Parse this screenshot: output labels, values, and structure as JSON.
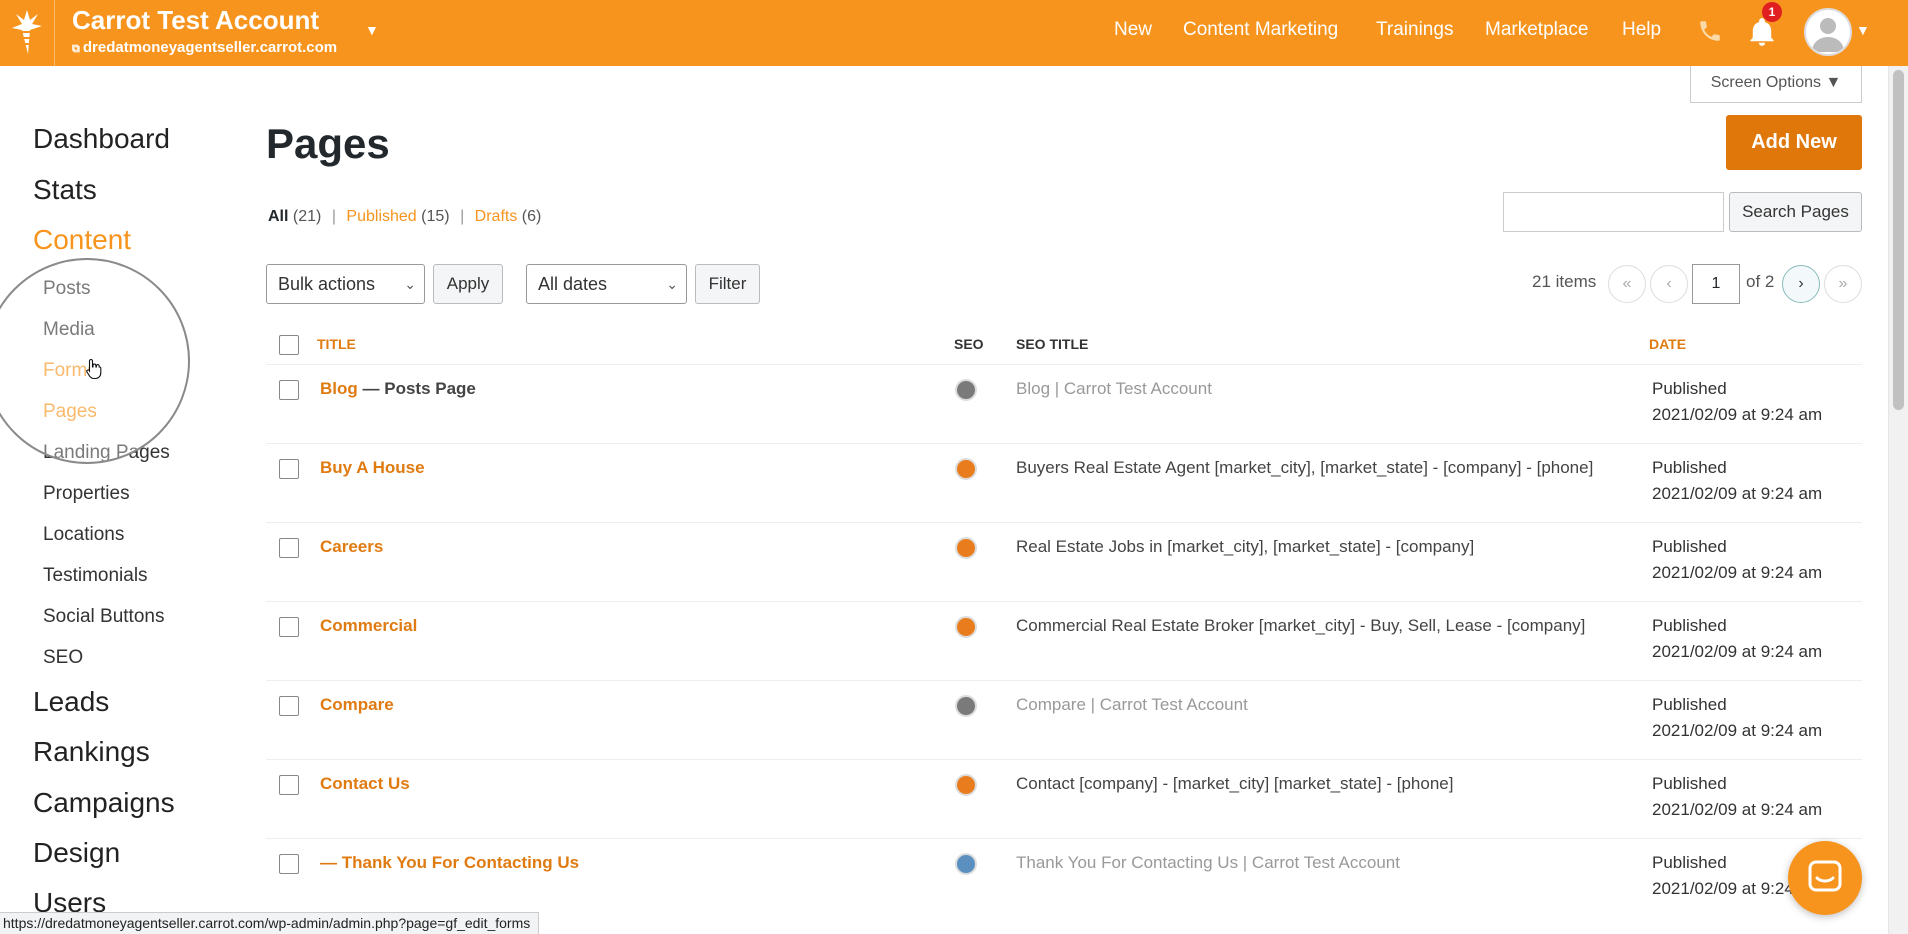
{
  "topbar": {
    "account_name": "Carrot Test Account",
    "account_url": "dredatmoneyagentseller.carrot.com",
    "nav": [
      "New",
      "Content Marketing",
      "Trainings",
      "Marketplace",
      "Help"
    ],
    "notification_count": "1",
    "accent_color": "#f7941d"
  },
  "sidebar": {
    "main_items": [
      "Dashboard",
      "Stats",
      "Content",
      "Leads",
      "Rankings",
      "Campaigns",
      "Design",
      "Users"
    ],
    "sub_items": [
      "Posts",
      "Media",
      "Forms",
      "Pages",
      "Landing Pages",
      "Properties",
      "Locations",
      "Testimonials",
      "Social Buttons",
      "SEO"
    ]
  },
  "screen_options": "Screen Options ▼",
  "page_title": "Pages",
  "add_new": "Add New",
  "filters": {
    "all_label": "All",
    "all_count": "(21)",
    "published_label": "Published",
    "published_count": "(15)",
    "drafts_label": "Drafts",
    "drafts_count": "(6)"
  },
  "search_button": "Search Pages",
  "bulk_actions": "Bulk actions",
  "apply": "Apply",
  "all_dates": "All dates",
  "filter": "Filter",
  "pagination": {
    "items": "21 items",
    "current_page": "1",
    "of_pages": "of 2",
    "first": "«",
    "prev": "‹",
    "next": "›",
    "last": "»"
  },
  "table": {
    "headers": {
      "title": "TITLE",
      "seo": "SEO",
      "seo_title": "SEO TITLE",
      "date": "DATE"
    },
    "rows": [
      {
        "title": "Blog",
        "suffix": " — Posts Page",
        "seo_color": "#7a7a7a",
        "seo_title": "Blog | Carrot Test Account",
        "muted": true,
        "status": "Published",
        "date": "2021/02/09 at 9:24 am"
      },
      {
        "title": "Buy A House",
        "suffix": "",
        "seo_color": "#e97d1e",
        "seo_title": "Buyers Real Estate Agent [market_city], [market_state] - [company] - [phone]",
        "muted": false,
        "status": "Published",
        "date": "2021/02/09 at 9:24 am"
      },
      {
        "title": "Careers",
        "suffix": "",
        "seo_color": "#e97d1e",
        "seo_title": "Real Estate Jobs in [market_city], [market_state] - [company]",
        "muted": false,
        "status": "Published",
        "date": "2021/02/09 at 9:24 am"
      },
      {
        "title": "Commercial",
        "suffix": "",
        "seo_color": "#e97d1e",
        "seo_title": "Commercial Real Estate Broker [market_city] - Buy, Sell, Lease - [company]",
        "muted": false,
        "status": "Published",
        "date": "2021/02/09 at 9:24 am"
      },
      {
        "title": "Compare",
        "suffix": "",
        "seo_color": "#7a7a7a",
        "seo_title": "Compare | Carrot Test Account",
        "muted": true,
        "status": "Published",
        "date": "2021/02/09 at 9:24 am"
      },
      {
        "title": "Contact Us",
        "suffix": "",
        "seo_color": "#e97d1e",
        "seo_title": "Contact [company] - [market_city] [market_state] - [phone]",
        "muted": false,
        "status": "Published",
        "date": "2021/02/09 at 9:24 am"
      },
      {
        "title": "— Thank You For Contacting Us",
        "suffix": "",
        "seo_color": "#5a8fc0",
        "seo_title": "Thank You For Contacting Us | Carrot Test Account",
        "muted": true,
        "status": "Published",
        "date": "2021/02/09 at 9:24 am"
      }
    ]
  },
  "status_bar_url": "https://dredatmoneyagentseller.carrot.com/wp-admin/admin.php?page=gf_edit_forms"
}
